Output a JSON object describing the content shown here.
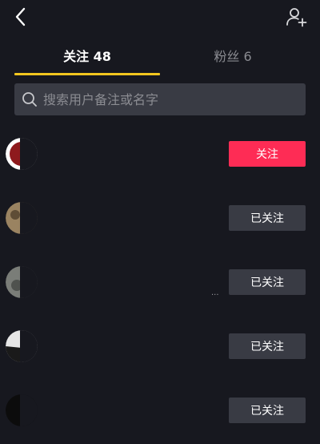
{
  "header": {
    "back_icon": "chevron-left-icon",
    "add_friend_icon": "user-plus-icon"
  },
  "tabs": [
    {
      "label": "关注 48",
      "active": true
    },
    {
      "label": "粉丝 6",
      "active": false
    }
  ],
  "active_tab_indicator_color": "#f2c61f",
  "search": {
    "placeholder": "搜索用户备注或名字",
    "value": "",
    "icon": "search-icon"
  },
  "users": [
    {
      "button_label": "关注",
      "followed": false,
      "avatar_color": "#8e1a1d",
      "suffix": ""
    },
    {
      "button_label": "已关注",
      "followed": true,
      "avatar_color": "#9a8361",
      "suffix": ""
    },
    {
      "button_label": "已关注",
      "followed": true,
      "avatar_color": "#7a7d78",
      "suffix": "..."
    },
    {
      "button_label": "已关注",
      "followed": true,
      "avatar_color": "#e6e6e6",
      "suffix": ""
    },
    {
      "button_label": "已关注",
      "followed": true,
      "avatar_color": "#0c0c0c",
      "suffix": ""
    }
  ],
  "colors": {
    "background": "#17181f",
    "follow_button": "#fe2c55",
    "following_button": "#393b44",
    "search_field": "#393b44"
  }
}
